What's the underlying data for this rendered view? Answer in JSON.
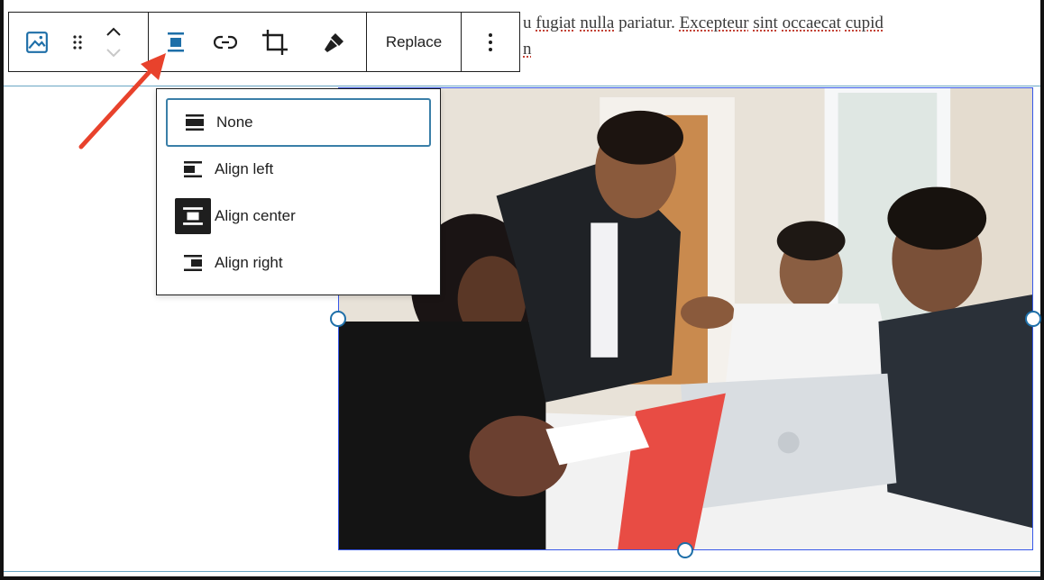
{
  "paragraph": {
    "line1_start": "u ",
    "line1_a": "fugiat",
    "line1_b": " ",
    "line1_c": "nulla",
    "line1_d": " pariatur. ",
    "line1_e": "Excepteur",
    "line1_f": " ",
    "line1_g": "sint",
    "line1_h": " ",
    "line1_i": "occaecat",
    "line1_j": " ",
    "line1_k": "cupid",
    "line2": "n"
  },
  "toolbar": {
    "block_icon": "image-icon",
    "drag_icon": "drag-handle-icon",
    "move_icon": "chevron-up-down-icon",
    "align_icon": "align-center-icon",
    "link_icon": "link-icon",
    "crop_icon": "crop-icon",
    "style_icon": "brush-icon",
    "replace_label": "Replace",
    "more_icon": "more-vertical-icon"
  },
  "align_menu": {
    "items": [
      {
        "label": "None",
        "icon": "align-none-icon",
        "active": true
      },
      {
        "label": "Align left",
        "icon": "align-left-icon",
        "active": false
      },
      {
        "label": "Align center",
        "icon": "align-center-icon",
        "active": false,
        "highlighted_icon": true
      },
      {
        "label": "Align right",
        "icon": "align-right-icon",
        "active": false
      }
    ]
  },
  "colors": {
    "accent": "#1e6fa8",
    "annotation_arrow": "#e8422c",
    "border": "#1e1e1e"
  }
}
